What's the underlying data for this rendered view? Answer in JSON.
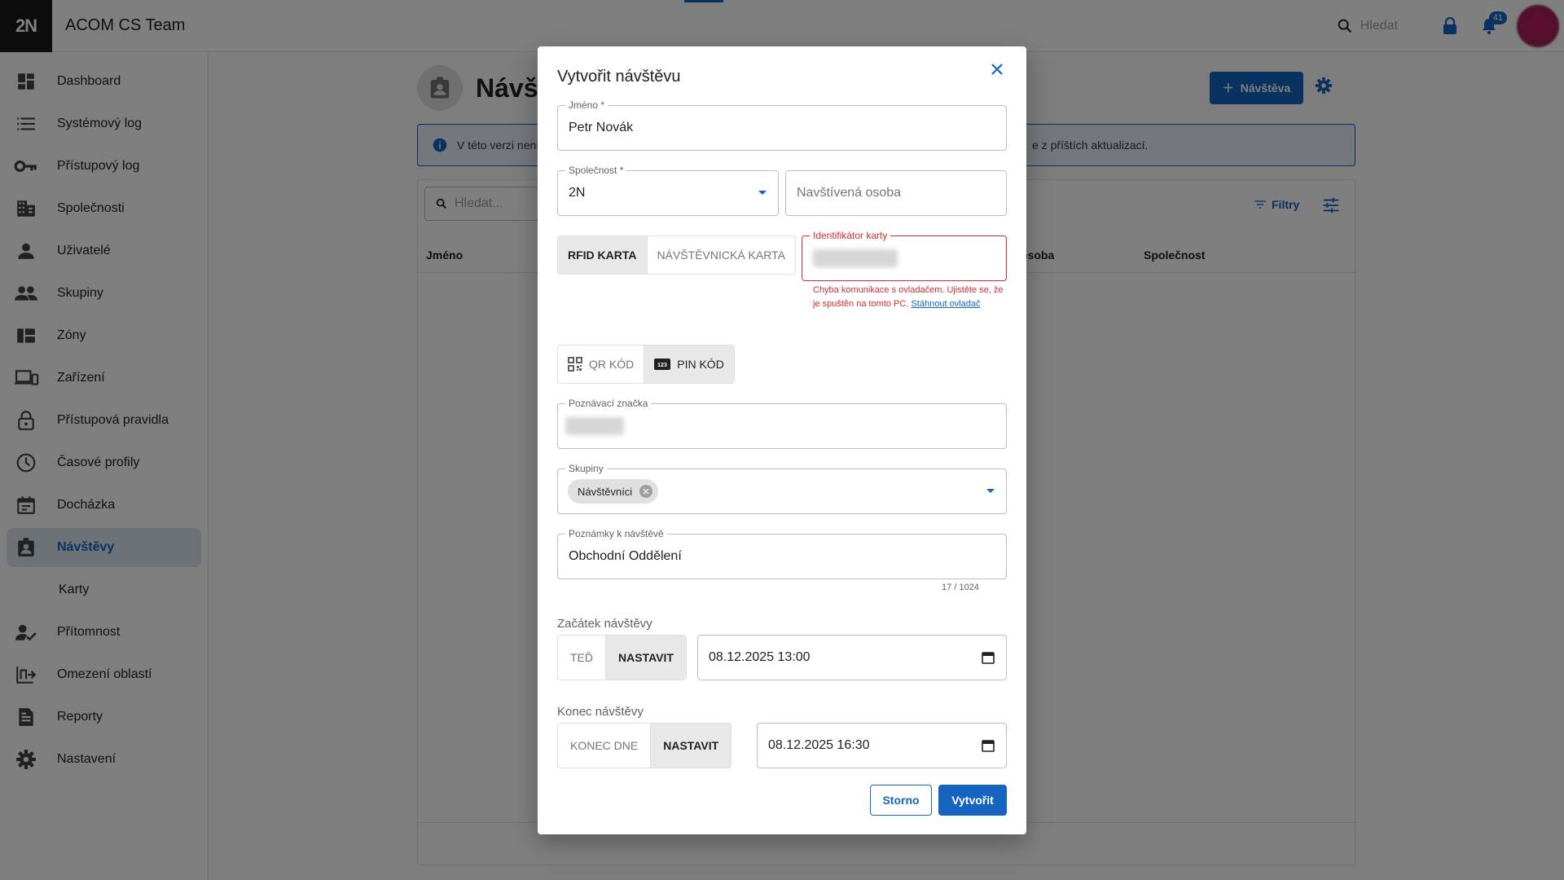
{
  "app": {
    "logo": "2N",
    "title": "ACOM CS Team"
  },
  "topbar": {
    "search_placeholder": "Hledat",
    "notification_count": "41"
  },
  "sidebar": {
    "items": [
      {
        "label": "Dashboard",
        "icon": "dashboard-icon"
      },
      {
        "label": "Systémový log",
        "icon": "list-icon"
      },
      {
        "label": "Přístupový log",
        "icon": "key-icon"
      },
      {
        "label": "Společnosti",
        "icon": "building-icon"
      },
      {
        "label": "Uživatelé",
        "icon": "person-icon"
      },
      {
        "label": "Skupiny",
        "icon": "group-icon"
      },
      {
        "label": "Zóny",
        "icon": "zones-icon"
      },
      {
        "label": "Zařízení",
        "icon": "devices-icon"
      },
      {
        "label": "Přístupová pravidla",
        "icon": "lock-icon"
      },
      {
        "label": "Časové profily",
        "icon": "clock-icon"
      },
      {
        "label": "Docházka",
        "icon": "calendar-icon"
      },
      {
        "label": "Návštěvy",
        "icon": "visitor-badge-icon",
        "active": true
      },
      {
        "label": "Karty",
        "sub": true
      },
      {
        "label": "Přítomnost",
        "icon": "person-check-icon"
      },
      {
        "label": "Omezení oblastí",
        "icon": "area-restriction-icon"
      },
      {
        "label": "Reporty",
        "icon": "report-icon"
      },
      {
        "label": "Nastavení",
        "icon": "gear-icon"
      }
    ]
  },
  "page": {
    "title": "Návšt",
    "add_button": "Návštěva",
    "info_text_start": "V této verzi není",
    "info_text_end": "e z příštích aktualizací.",
    "search_placeholder": "Hledat...",
    "filters_label": "Filtry",
    "columns": {
      "name": "Jméno",
      "person": "osoba",
      "company": "Společnost"
    }
  },
  "modal": {
    "title": "Vytvořit návštěvu",
    "name": {
      "label": "Jméno *",
      "value": "Petr Novák"
    },
    "company": {
      "label": "Společnost *",
      "value": "2N"
    },
    "visited_person": {
      "placeholder": "Navštívená osoba"
    },
    "card_type": {
      "options": [
        "RFID KARTA",
        "NÁVŠTĚVNICKÁ KARTA"
      ],
      "selected": "RFID KARTA"
    },
    "card_id": {
      "label": "Identifikátor karty"
    },
    "error": {
      "text": "Chyba komunikace s ovladačem. Ujistěte se, že je spuštěn na tomto PC.",
      "link": "Stáhnout ovladač"
    },
    "code_type": {
      "options": [
        "QR KÓD",
        "PIN KÓD"
      ],
      "selected": "PIN KÓD"
    },
    "license_plate": {
      "label": "Poznávací značka"
    },
    "groups": {
      "label": "Skupiny",
      "chip": "Návštěvníci"
    },
    "notes": {
      "label": "Poznámky k návštěvě",
      "value": "Obchodní Oddělení",
      "counter": "17 / 1024"
    },
    "start": {
      "label": "Začátek návštěvy",
      "btn_now": "TEĎ",
      "btn_set": "NASTAVIT",
      "value": "08.12.2025 13:00"
    },
    "end": {
      "label": "Konec návštěvy",
      "btn_end_day": "KONEC DNE",
      "btn_set": "NASTAVIT",
      "value": "08.12.2025 16:30"
    },
    "cancel": "Storno",
    "create": "Vytvořit"
  },
  "colors": {
    "primary": "#1565c0",
    "error": "#d32f2f",
    "overlay": "rgba(0,0,0,0.5)"
  }
}
